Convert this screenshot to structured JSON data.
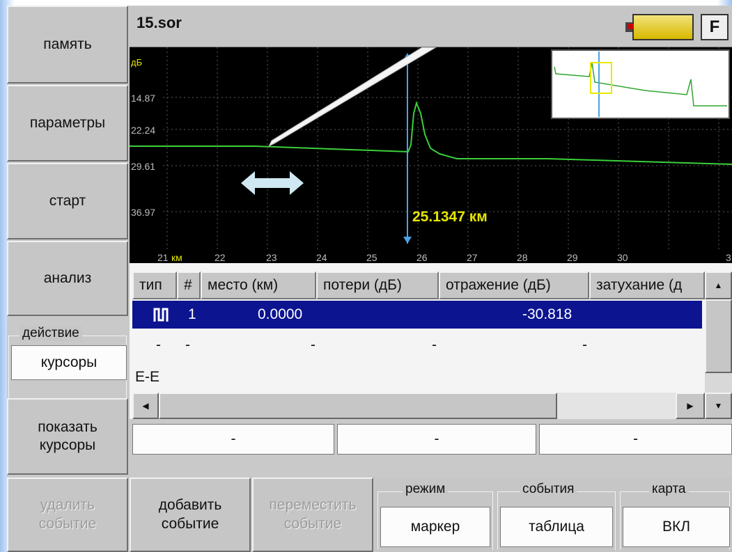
{
  "sidebar": {
    "memory": "память",
    "parameters": "параметры",
    "start": "старт",
    "analysis": "анализ",
    "action_label": "действие",
    "action_value": "курсоры",
    "show_cursors_line1": "показать",
    "show_cursors_line2": "курсоры"
  },
  "header": {
    "filename": "15.sor",
    "f_key": "F"
  },
  "plot": {
    "y_unit": "дБ",
    "y_ticks": [
      "14.87",
      "22.24",
      "29.61",
      "36.97"
    ],
    "x_ticks": [
      "21",
      "22",
      "23",
      "24",
      "25",
      "26",
      "27",
      "28",
      "29",
      "30",
      "3"
    ],
    "x_unit": "км",
    "cursor_readout": "25.1347 км"
  },
  "table": {
    "columns": [
      "тип",
      "#",
      "место (км)",
      "потери (дБ)",
      "отражение (дБ)",
      "затухание (д"
    ],
    "rows": [
      {
        "type_icon": "reflective-event-icon",
        "num": "1",
        "location": "0.0000",
        "loss": "",
        "reflection": "-30.818",
        "attenuation": ""
      },
      {
        "type": "-",
        "num": "-",
        "location": "-",
        "loss": "-",
        "reflection": "-",
        "attenuation": ""
      },
      {
        "type": "E-E"
      }
    ]
  },
  "cursor_values": [
    "-",
    "-",
    "-"
  ],
  "bottom": {
    "delete_line1": "удалить",
    "delete_line2": "событие",
    "add_line1": "добавить",
    "add_line2": "событие",
    "move_line1": "переместить",
    "move_line2": "событие",
    "mode_label": "режим",
    "mode_value": "маркер",
    "events_label": "события",
    "events_value": "таблица",
    "map_label": "карта",
    "map_value": "ВКЛ"
  },
  "colors": {
    "trace": "#3bd13b",
    "cursor": "#4aa3e6",
    "selection": "#0c1490",
    "marker": "#e8e800"
  }
}
